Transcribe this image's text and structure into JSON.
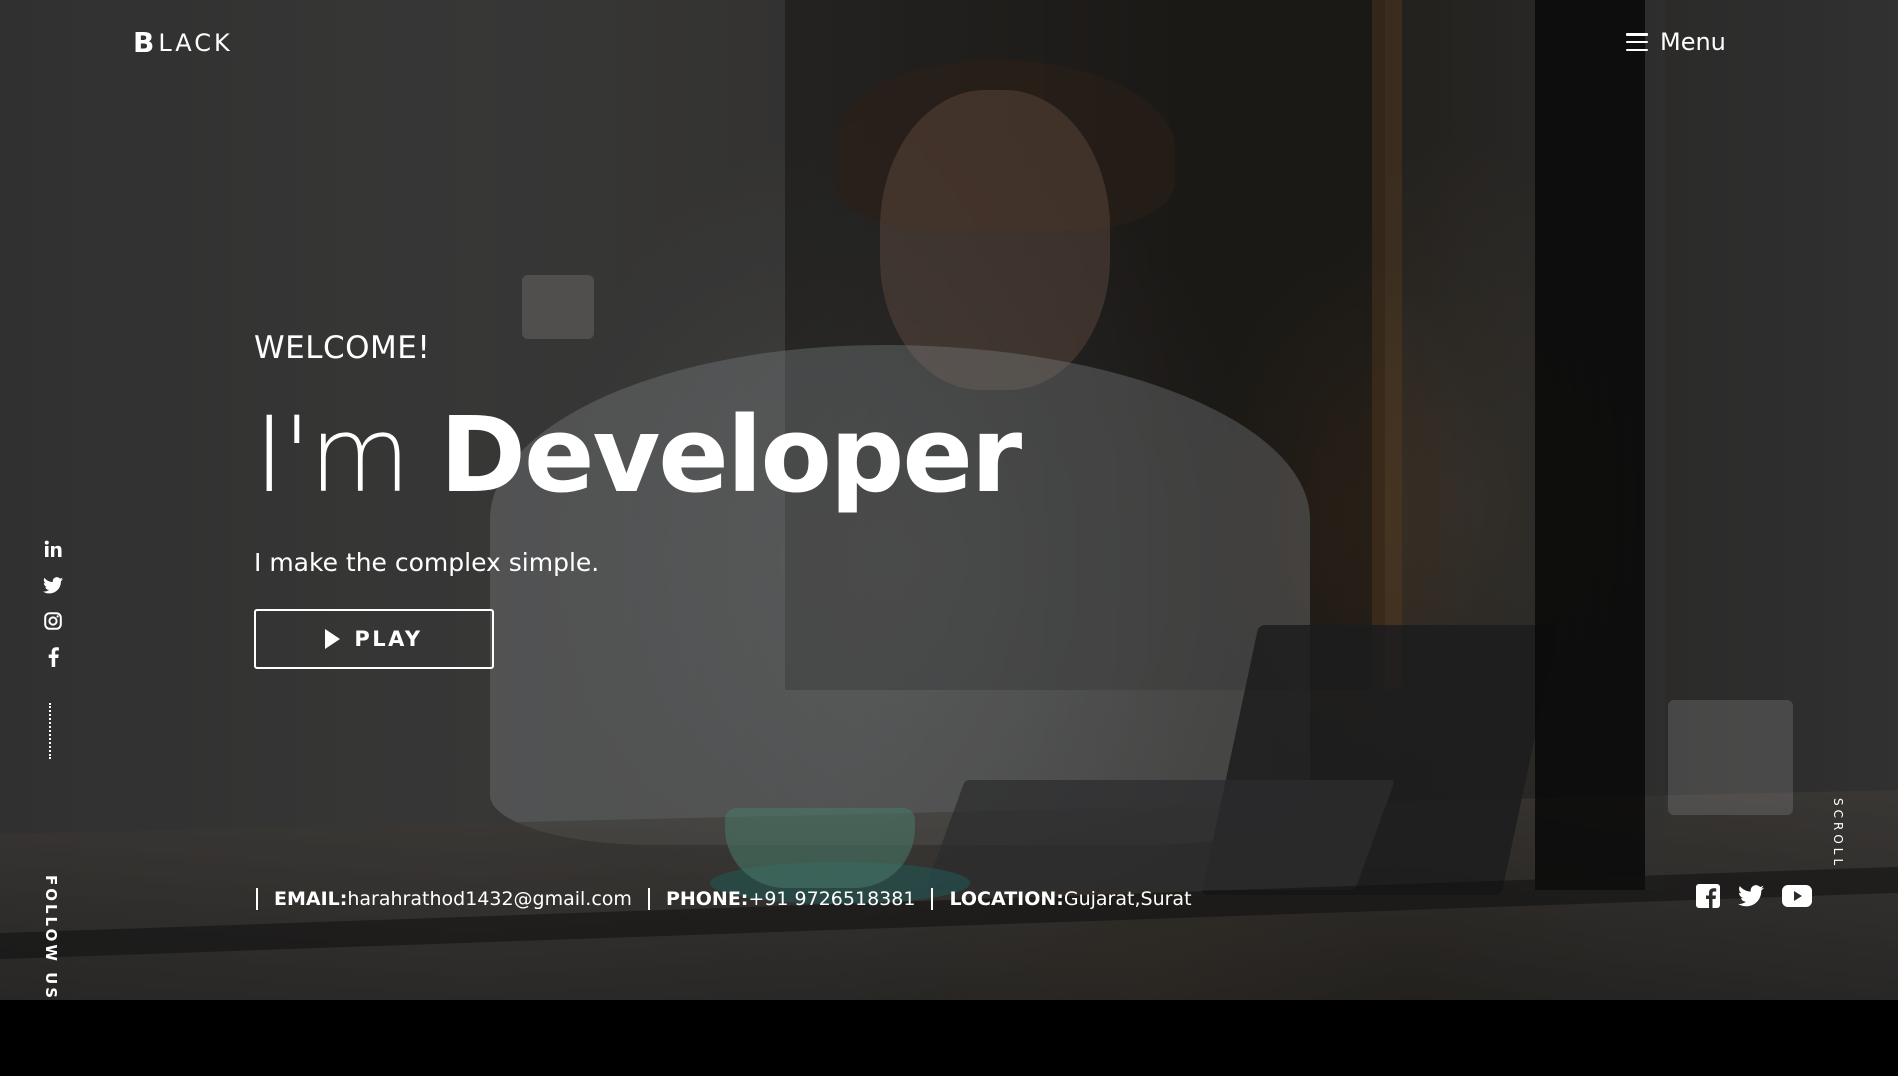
{
  "header": {
    "logo_mark": "B",
    "logo_text": "LACK",
    "menu_label": "Menu"
  },
  "hero": {
    "welcome": "WELCOME!",
    "headline_light": "I'm ",
    "headline_bold": "Developer",
    "tagline": "I make the complex simple.",
    "play_label": "PLAY"
  },
  "social_sidebar": {
    "icons": [
      "linkedin-icon",
      "twitter-icon",
      "instagram-icon",
      "facebook-icon"
    ],
    "follow_label": "FOLLOW US"
  },
  "contact": {
    "email_key": "EMAIL:",
    "email_value": "harahrathod1432@gmail.com",
    "phone_key": "PHONE:",
    "phone_value": "+91 9726518381",
    "location_key": "LOCATION:",
    "location_value": "Gujarat,Surat"
  },
  "scroll_label": "SCROLL",
  "bottom_icons": [
    "facebook-square-icon",
    "twitter-icon",
    "youtube-icon"
  ],
  "colors": {
    "text": "#ffffff",
    "bottom_bar": "#000000"
  }
}
